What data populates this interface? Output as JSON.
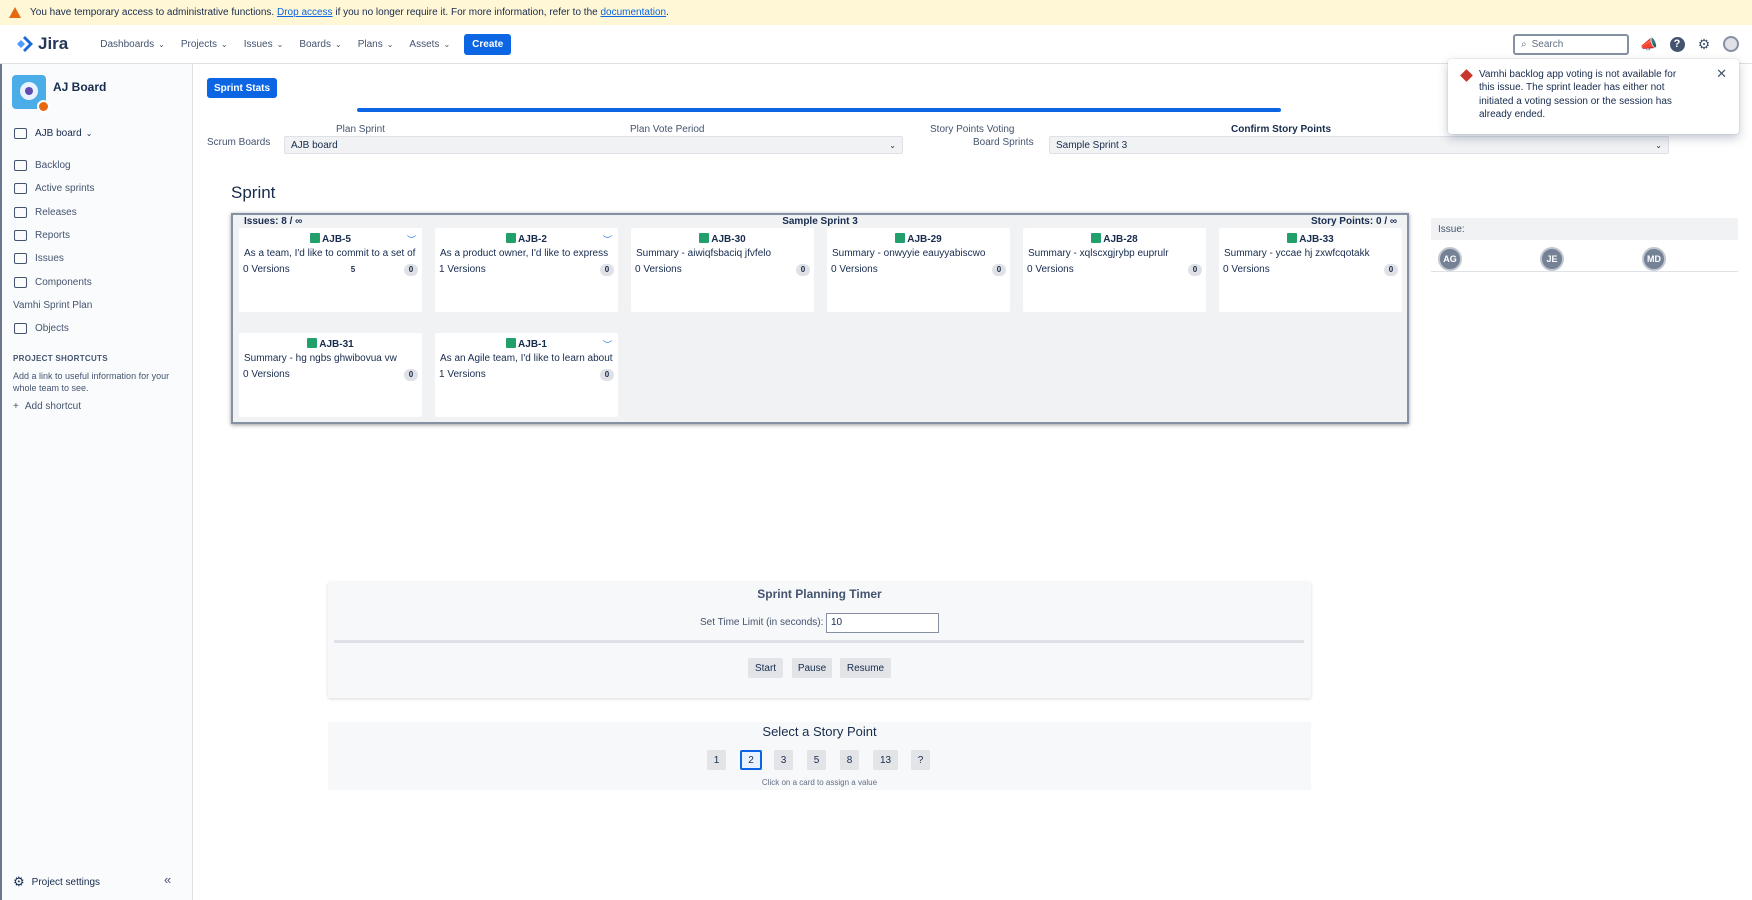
{
  "banner": {
    "text_before": "You have temporary access to administrative functions.",
    "link_drop": "Drop access",
    "text_middle": "if you no longer require it. For more information, refer to the",
    "link_docs": "documentation",
    "text_after": "."
  },
  "topnav": {
    "logo_text": "Jira",
    "items": [
      "Dashboards",
      "Projects",
      "Issues",
      "Boards",
      "Plans",
      "Assets"
    ],
    "create_label": "Create",
    "search_placeholder": "Search"
  },
  "sidebar": {
    "project_name": "AJ Board",
    "board_selector": "AJB board",
    "items": [
      {
        "label": "Backlog",
        "icon": "backlog-icon"
      },
      {
        "label": "Active sprints",
        "icon": "board-icon"
      },
      {
        "label": "Releases",
        "icon": "ship-icon"
      },
      {
        "label": "Reports",
        "icon": "chart-icon"
      },
      {
        "label": "Issues",
        "icon": "issues-icon"
      },
      {
        "label": "Components",
        "icon": "component-icon"
      },
      {
        "label": "Vamhi Sprint Plan",
        "icon": ""
      },
      {
        "label": "Objects",
        "icon": "objects-icon"
      }
    ],
    "shortcuts_heading": "PROJECT SHORTCUTS",
    "shortcuts_desc": "Add a link to useful information for your whole team to see.",
    "add_shortcut": "Add shortcut",
    "project_settings": "Project settings"
  },
  "main": {
    "sprint_stats_label": "Sprint Stats",
    "steps": [
      "Plan Sprint",
      "Plan Vote Period",
      "Story Points Voting",
      "Confirm Story Points"
    ],
    "scrum_boards_label": "Scrum Boards",
    "scrum_boards_value": "AJB board",
    "board_sprints_label": "Board Sprints",
    "board_sprints_value": "Sample Sprint 3",
    "sprint_heading": "Sprint",
    "board": {
      "issues_count": "Issues: 8 / ∞",
      "sprint_name": "Sample Sprint 3",
      "story_points": "Story Points: 0 / ∞",
      "cards": [
        {
          "key": "AJB-5",
          "summary": "As a team, I'd like to commit to a set of",
          "versions": "0 Versions",
          "count": "0",
          "extra": "5",
          "expandable": true
        },
        {
          "key": "AJB-2",
          "summary": "As a product owner, I'd like to express",
          "versions": "1 Versions",
          "count": "0",
          "extra": "",
          "expandable": true
        },
        {
          "key": "AJB-30",
          "summary": "Summary - aiwiqfsbaciq jfvfelo",
          "versions": "0 Versions",
          "count": "0",
          "extra": "",
          "expandable": false
        },
        {
          "key": "AJB-29",
          "summary": "Summary - onwyyie eauyyabiscwo",
          "versions": "0 Versions",
          "count": "0",
          "extra": "",
          "expandable": false
        },
        {
          "key": "AJB-28",
          "summary": "Summary - xqlscxgjrybp euprulr",
          "versions": "0 Versions",
          "count": "0",
          "extra": "",
          "expandable": false
        },
        {
          "key": "AJB-33",
          "summary": "Summary - yccae hj zxwfcqotakk",
          "versions": "0 Versions",
          "count": "0",
          "extra": "",
          "expandable": false
        },
        {
          "key": "AJB-31",
          "summary": "Summary - hg ngbs ghwibovua vw",
          "versions": "0 Versions",
          "count": "0",
          "extra": "",
          "expandable": false
        },
        {
          "key": "AJB-1",
          "summary": "As an Agile team, I'd like to learn about",
          "versions": "1 Versions",
          "count": "0",
          "extra": "",
          "expandable": true
        }
      ]
    },
    "issue_panel": {
      "label": "Issue:",
      "voters": [
        "AG",
        "JE",
        "MD"
      ]
    },
    "toast": {
      "message": "Vamhi backlog app voting is not available for this issue. The sprint leader has either not initiated a voting session or the session has already ended."
    },
    "timer": {
      "title": "Sprint Planning Timer",
      "label": "Set Time Limit (in seconds):",
      "value": "10",
      "buttons": [
        "Start",
        "Pause",
        "Resume"
      ]
    },
    "points": {
      "title": "Select a Story Point",
      "options": [
        "1",
        "2",
        "3",
        "5",
        "8",
        "13",
        "?"
      ],
      "selected": "2",
      "hint": "Click on a card to assign a value"
    }
  },
  "colors": {
    "accent": "#0c66e4",
    "banner_bg": "#fff7d6",
    "error": "#c9372c",
    "story": "#22a06b"
  }
}
